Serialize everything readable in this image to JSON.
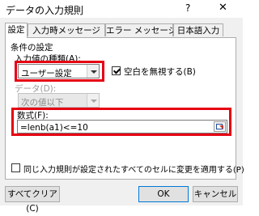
{
  "window": {
    "title": "データの入力規則",
    "help": "?",
    "close": "✕"
  },
  "tabs": [
    "設定",
    "入力時メッセージ",
    "エラー メッセージ",
    "日本語入力"
  ],
  "settings": {
    "section_title": "条件の設定",
    "allow_label": "入力値の種類(A):",
    "allow_value": "ユーザー設定",
    "ignore_blank_label": "空白を無視する(B)",
    "ignore_blank_checked": true,
    "data_label": "データ(D):",
    "data_value": "次の値以下",
    "formula_label": "数式(F):",
    "formula_value": "=lenb(a1)<=10",
    "apply_all_label": "同じ入力規則が設定されたすべてのセルに変更を適用する(P)",
    "apply_all_checked": false
  },
  "buttons": {
    "clear_all": "すべてクリア(C)",
    "ok": "OK",
    "cancel": "キャンセル"
  },
  "colors": {
    "highlight": "#e60012",
    "panel": "#ffffff",
    "dialog": "#f0f0f0",
    "default_button_border": "#0078d7"
  }
}
